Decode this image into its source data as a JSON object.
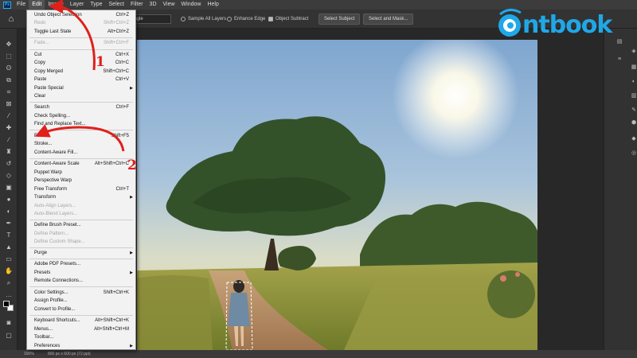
{
  "menubar": {
    "items": [
      "File",
      "Edit",
      "Image",
      "Layer",
      "Type",
      "Select",
      "Filter",
      "3D",
      "View",
      "Window",
      "Help"
    ],
    "active": "Edit"
  },
  "options": {
    "mode": "angle",
    "sample_all_layers": "Sample All Layers",
    "enhance_edge": "Enhance Edge",
    "object_subtract": "Object Subtract",
    "select_subject": "Select Subject",
    "select_and_mask": "Select and Mask..."
  },
  "edit_menu": {
    "items": [
      {
        "label": "Undo Object Selection",
        "shortcut": "Ctrl+Z",
        "disabled": false
      },
      {
        "label": "Redo",
        "shortcut": "Shift+Ctrl+Z",
        "disabled": true
      },
      {
        "label": "Toggle Last State",
        "shortcut": "Alt+Ctrl+Z",
        "disabled": false
      },
      {
        "label": "Fade...",
        "shortcut": "Shift+Ctrl+F",
        "disabled": true
      },
      {
        "label": "Cut",
        "shortcut": "Ctrl+X",
        "disabled": false
      },
      {
        "label": "Copy",
        "shortcut": "Ctrl+C",
        "disabled": false
      },
      {
        "label": "Copy Merged",
        "shortcut": "Shift+Ctrl+C",
        "disabled": false
      },
      {
        "label": "Paste",
        "shortcut": "Ctrl+V",
        "disabled": false
      },
      {
        "label": "Paste Special",
        "shortcut": "",
        "disabled": false,
        "submenu": true
      },
      {
        "label": "Clear",
        "shortcut": "",
        "disabled": false
      },
      {
        "label": "Search",
        "shortcut": "Ctrl+F",
        "disabled": false
      },
      {
        "label": "Check Spelling...",
        "shortcut": "",
        "disabled": false
      },
      {
        "label": "Find and Replace Text...",
        "shortcut": "",
        "disabled": false
      },
      {
        "label": "Fill...",
        "shortcut": "Shift+F5",
        "disabled": false
      },
      {
        "label": "Stroke...",
        "shortcut": "",
        "disabled": false
      },
      {
        "label": "Content-Aware Fill...",
        "shortcut": "",
        "disabled": false
      },
      {
        "label": "Content-Aware Scale",
        "shortcut": "Alt+Shift+Ctrl+C",
        "disabled": false
      },
      {
        "label": "Puppet Warp",
        "shortcut": "",
        "disabled": false
      },
      {
        "label": "Perspective Warp",
        "shortcut": "",
        "disabled": false
      },
      {
        "label": "Free Transform",
        "shortcut": "Ctrl+T",
        "disabled": false
      },
      {
        "label": "Transform",
        "shortcut": "",
        "disabled": false,
        "submenu": true
      },
      {
        "label": "Auto-Align Layers...",
        "shortcut": "",
        "disabled": true
      },
      {
        "label": "Auto-Blend Layers...",
        "shortcut": "",
        "disabled": true
      },
      {
        "label": "Define Brush Preset...",
        "shortcut": "",
        "disabled": false
      },
      {
        "label": "Define Pattern...",
        "shortcut": "",
        "disabled": true
      },
      {
        "label": "Define Custom Shape...",
        "shortcut": "",
        "disabled": true
      },
      {
        "label": "Purge",
        "shortcut": "",
        "disabled": false,
        "submenu": true
      },
      {
        "label": "Adobe PDF Presets...",
        "shortcut": "",
        "disabled": false
      },
      {
        "label": "Presets",
        "shortcut": "",
        "disabled": false,
        "submenu": true
      },
      {
        "label": "Remote Connections...",
        "shortcut": "",
        "disabled": false
      },
      {
        "label": "Color Settings...",
        "shortcut": "Shift+Ctrl+K",
        "disabled": false
      },
      {
        "label": "Assign Profile...",
        "shortcut": "",
        "disabled": false
      },
      {
        "label": "Convert to Profile...",
        "shortcut": "",
        "disabled": false
      },
      {
        "label": "Keyboard Shortcuts...",
        "shortcut": "Alt+Shift+Ctrl+K",
        "disabled": false
      },
      {
        "label": "Menus...",
        "shortcut": "Alt+Shift+Ctrl+M",
        "disabled": false
      },
      {
        "label": "Toolbar...",
        "shortcut": "",
        "disabled": false
      },
      {
        "label": "Preferences",
        "shortcut": "",
        "disabled": false,
        "submenu": true
      }
    ]
  },
  "annotation": {
    "step1": "1",
    "step2": "2",
    "color": "#e0201b"
  },
  "brand": {
    "name": "ntbook",
    "color": "#1fa8e8"
  },
  "status": {
    "zoom": "100%",
    "doc": "800 px x 600 px (72 ppi)"
  },
  "icons": {
    "home": "home-icon",
    "submenu": "chevron-right-icon"
  }
}
